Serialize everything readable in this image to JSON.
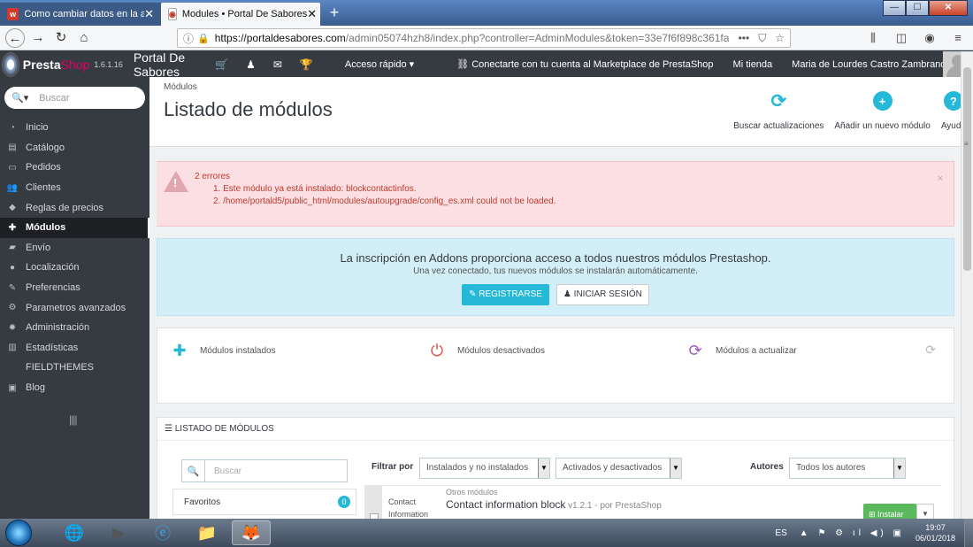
{
  "browser": {
    "tabs": [
      {
        "title": "Como cambiar datos en la adm",
        "favicon": "wp-icon",
        "active": false
      },
      {
        "title": "Modules • Portal De Sabores",
        "favicon": "prestashop-icon",
        "active": true
      }
    ],
    "new_tab": "+",
    "url": {
      "host": "https://portaldesabores.com",
      "path": "/admin05074hzh8/index.php?controller=AdminModules&token=33e7f6f898c361fa",
      "actions": "•••"
    },
    "window_buttons": {
      "minimize": "—",
      "maximize": "☐",
      "close": "✕"
    }
  },
  "header": {
    "brand": {
      "presta": "Presta",
      "shop": "Shop"
    },
    "version": "1.6.1.16",
    "shop_name": "Portal De Sabores",
    "quick_access": "Acceso rápido ▾",
    "marketplace": "Conectarte con tu cuenta al Marketplace de PrestaShop",
    "my_shop": "Mi tienda",
    "user": "Maria de Lourdes Castro Zambrano ▾"
  },
  "sidebar": {
    "search_placeholder": "Buscar",
    "items": [
      {
        "label": "Inicio",
        "icon": "dashboard-icon",
        "glyph": "◔"
      },
      {
        "label": "Catálogo",
        "icon": "catalog-icon",
        "glyph": "▤"
      },
      {
        "label": "Pedidos",
        "icon": "orders-icon",
        "glyph": "▭"
      },
      {
        "label": "Clientes",
        "icon": "customers-icon",
        "glyph": "👥"
      },
      {
        "label": "Reglas de precios",
        "icon": "tag-icon",
        "glyph": "◆"
      },
      {
        "label": "Módulos",
        "icon": "puzzle-icon",
        "glyph": "✚",
        "active": true
      },
      {
        "label": "Envío",
        "icon": "truck-icon",
        "glyph": "▰"
      },
      {
        "label": "Localización",
        "icon": "globe-icon",
        "glyph": "●"
      },
      {
        "label": "Preferencias",
        "icon": "wrench-icon",
        "glyph": "✎"
      },
      {
        "label": "Parametros avanzados",
        "icon": "cogs-icon",
        "glyph": "⚙"
      },
      {
        "label": "Administración",
        "icon": "gear-icon",
        "glyph": "✹"
      },
      {
        "label": "Estadísticas",
        "icon": "chart-icon",
        "glyph": "▥"
      },
      {
        "label": "FIELDTHEMES",
        "icon": "",
        "glyph": ""
      },
      {
        "label": "Blog",
        "icon": "blog-icon",
        "glyph": "▣"
      }
    ],
    "collapse": "||||"
  },
  "page": {
    "breadcrumb": "Módulos",
    "title": "Listado de módulos",
    "toolbar": {
      "updates": "Buscar actualizaciones",
      "add_module": "Añadir un nuevo módulo",
      "help": "Ayuda"
    }
  },
  "alert": {
    "title": "2 errores",
    "errors": [
      "1. Este módulo ya está instalado: blockcontactinfos.",
      "2. /home/portald5/public_html/modules/autoupgrade/config_es.xml could not be loaded."
    ],
    "close": "×"
  },
  "addons": {
    "title": "La inscripción en Addons proporciona acceso a todos nuestros módulos Prestashop.",
    "subtitle": "Una vez conectado, tus nuevos módulos se instalarán automáticamente.",
    "register": "✎ REGISTRARSE",
    "login": "INICIAR SESIÓN"
  },
  "stats": {
    "installed": "Módulos instalados",
    "disabled": "Módulos desactivados",
    "to_update": "Módulos a actualizar"
  },
  "module_list": {
    "heading": "☰ LISTADO DE MÓDULOS",
    "search_placeholder": "Buscar",
    "favorites": {
      "label": "Favoritos",
      "count": "0"
    },
    "filter_label": "Filtrar por",
    "filter_install": "Instalados y no instalados",
    "filter_enabled": "Activados y desactivados",
    "authors_label": "Autores",
    "authors_value": "Todos los autores",
    "row": {
      "short_name": "Contact Information",
      "category": "Otros módulos",
      "name": "Contact information block",
      "meta": " v1.2.1 - por PrestaShop",
      "install": "Instalar"
    }
  },
  "taskbar": {
    "lang": "ES",
    "time": "19:07",
    "date": "06/01/2018"
  }
}
